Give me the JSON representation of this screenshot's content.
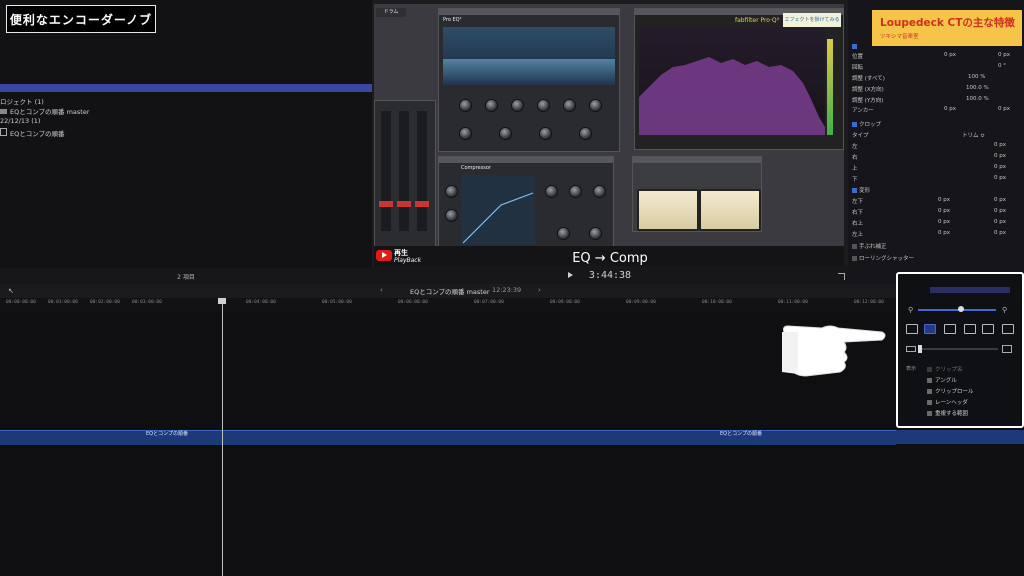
{
  "title_box": "便利なエンコーダーノブ",
  "badge": {
    "title": "Loupedeck CTの主な特徴",
    "subtitle": "ツキシマ音楽室"
  },
  "browser": {
    "rows": [
      {
        "text": "ロジェクト  (1)"
      },
      {
        "text": "EQとコンプの順番 master"
      },
      {
        "text": "22/12/13  (1)"
      },
      {
        "text": "EQとコンプの順番"
      }
    ],
    "footer": "2 項目"
  },
  "viewer": {
    "caption": "EQ → Comp",
    "timecode": "3:44:38",
    "yt_label1": "再生",
    "yt_label2": "PlayBack",
    "drum_tag": "ドラム",
    "proq_brand": "fabfilter  Pro·Q³",
    "fx_note": "エフェクトを掛けてみる",
    "eq_title": "Pro EQ²",
    "comp_title": "Compressor"
  },
  "inspector": {
    "rows": [
      {
        "label": "位置",
        "x": "0 px",
        "y": "0 px"
      },
      {
        "label": "回転",
        "value": "0 °"
      },
      {
        "label": "調整 (すべて)",
        "value": "100 %"
      },
      {
        "label": "調整 (X方向)",
        "value": "100.0 %"
      },
      {
        "label": "調整 (Y方向)",
        "value": "100.0 %"
      },
      {
        "label": "アンカー",
        "x": "0 px",
        "y": "0 px"
      }
    ],
    "crop": {
      "header": "クロップ",
      "type_label": "タイプ",
      "type_value": "トリム ≎",
      "sides": [
        "左",
        "右",
        "上",
        "下"
      ],
      "side_value": "0 px"
    },
    "distort": {
      "header": "変形",
      "corners": [
        "左下",
        "右下",
        "右上",
        "左上"
      ],
      "value": "0 px"
    },
    "stabilize": "手ぶれ補正",
    "rolling": "ローリングシャッター"
  },
  "timeline": {
    "project_name": "EQとコンプの順番 master",
    "duration": "12:23:39",
    "ticks": [
      "00:00:00:00",
      "00:01:00:00",
      "00:02:00:00",
      "00:03:00:00",
      "00:04:00:00",
      "00:05:00:00",
      "00:06:00:00",
      "00:07:00:00",
      "00:08:00:00",
      "00:09:00:00",
      "00:10:00:00",
      "00:11:00:00",
      "00:12:00:00"
    ],
    "clip1": "EQとコンプの順番",
    "clip2": "EQとコンプの順番"
  },
  "popup": {
    "display_label": "表示",
    "options": [
      {
        "label": "クリップ名",
        "enabled": false
      },
      {
        "label": "アングル",
        "enabled": true
      },
      {
        "label": "クリップロール",
        "enabled": true
      },
      {
        "label": "レーンヘッダ",
        "enabled": true
      },
      {
        "label": "重複する範囲",
        "enabled": true
      }
    ]
  },
  "colors": {
    "accent_blue": "#3b45a6",
    "badge_bg": "#f6c448",
    "badge_text": "#cf2f20",
    "clip_blue": "#1d3a78",
    "eq_purple": "#7a3d8f"
  }
}
